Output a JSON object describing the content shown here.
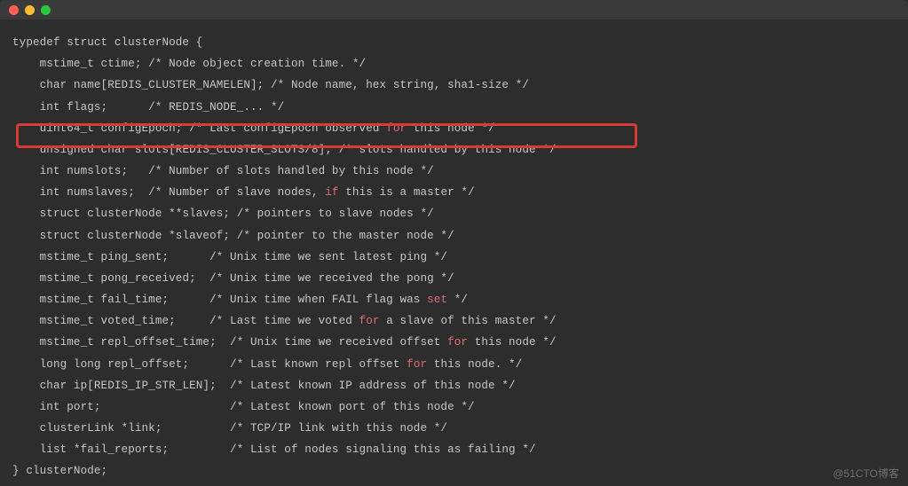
{
  "titleBar": {
    "dots": [
      "close",
      "minimize",
      "zoom"
    ]
  },
  "watermark": "@51CTO博客",
  "code": {
    "lines": [
      {
        "indent": 0,
        "segs": [
          {
            "t": "typedef struct clusterNode {"
          }
        ]
      },
      {
        "indent": 1,
        "segs": [
          {
            "t": "mstime_t ctime; /* Node object creation time. */"
          }
        ]
      },
      {
        "indent": 1,
        "segs": [
          {
            "t": "char name[REDIS_CLUSTER_NAMELEN]; /* Node name, hex string, sha1-size */"
          }
        ]
      },
      {
        "indent": 1,
        "segs": [
          {
            "t": "int flags;      /* REDIS_NODE_... */"
          }
        ]
      },
      {
        "indent": 1,
        "segs": [
          {
            "t": "uint64_t configEpoch; /* Last configEpoch observed "
          },
          {
            "t": "for",
            "c": "kw"
          },
          {
            "t": " this node */"
          }
        ]
      },
      {
        "indent": 1,
        "segs": [
          {
            "t": "unsigned char slots[REDIS_CLUSTER_SLOTS/8]; /* slots handled by this node */"
          }
        ],
        "highlight": true
      },
      {
        "indent": 1,
        "segs": [
          {
            "t": "int numslots;   /* Number of slots handled by this node */"
          }
        ]
      },
      {
        "indent": 1,
        "segs": [
          {
            "t": "int numslaves;  /* Number of slave nodes, "
          },
          {
            "t": "if",
            "c": "kw"
          },
          {
            "t": " this is a master */"
          }
        ]
      },
      {
        "indent": 1,
        "segs": [
          {
            "t": "struct clusterNode **slaves; /* pointers to slave nodes */"
          }
        ]
      },
      {
        "indent": 1,
        "segs": [
          {
            "t": "struct clusterNode *slaveof; /* pointer to the master node */"
          }
        ]
      },
      {
        "indent": 1,
        "segs": [
          {
            "t": "mstime_t ping_sent;      /* Unix time we sent latest ping */"
          }
        ]
      },
      {
        "indent": 1,
        "segs": [
          {
            "t": "mstime_t pong_received;  /* Unix time we received the pong */"
          }
        ]
      },
      {
        "indent": 1,
        "segs": [
          {
            "t": "mstime_t fail_time;      /* Unix time when FAIL flag was "
          },
          {
            "t": "set",
            "c": "kw"
          },
          {
            "t": " */"
          }
        ]
      },
      {
        "indent": 1,
        "segs": [
          {
            "t": "mstime_t voted_time;     /* Last time we voted "
          },
          {
            "t": "for",
            "c": "kw"
          },
          {
            "t": " a slave of this master */"
          }
        ]
      },
      {
        "indent": 1,
        "segs": [
          {
            "t": "mstime_t repl_offset_time;  /* Unix time we received offset "
          },
          {
            "t": "for",
            "c": "kw"
          },
          {
            "t": " this node */"
          }
        ]
      },
      {
        "indent": 1,
        "segs": [
          {
            "t": "long long repl_offset;      /* Last known repl offset "
          },
          {
            "t": "for",
            "c": "kw"
          },
          {
            "t": " this node. */"
          }
        ]
      },
      {
        "indent": 1,
        "segs": [
          {
            "t": "char ip[REDIS_IP_STR_LEN];  /* Latest known IP address of this node */"
          }
        ]
      },
      {
        "indent": 1,
        "segs": [
          {
            "t": "int port;                   /* Latest known port of this node */"
          }
        ]
      },
      {
        "indent": 1,
        "segs": [
          {
            "t": "clusterLink *link;          /* TCP/IP link with this node */"
          }
        ]
      },
      {
        "indent": 1,
        "segs": [
          {
            "t": "list *fail_reports;         /* List of nodes signaling this as failing */"
          }
        ]
      },
      {
        "indent": 0,
        "segs": [
          {
            "t": "} clusterNode;"
          }
        ]
      }
    ]
  }
}
